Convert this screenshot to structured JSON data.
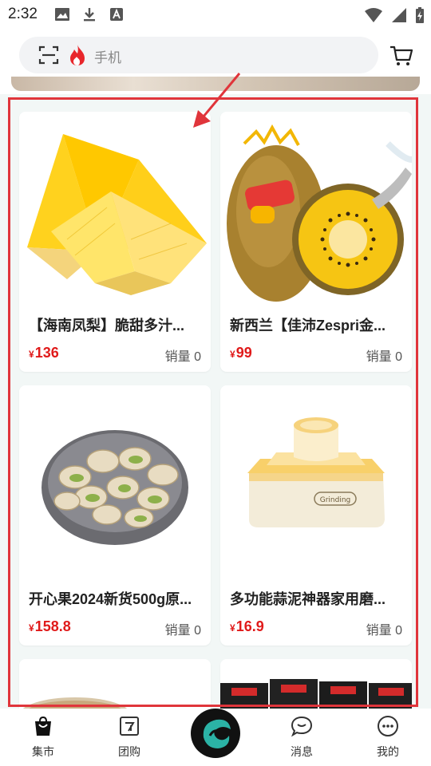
{
  "status_bar": {
    "time": "2:32"
  },
  "search": {
    "placeholder": "手机"
  },
  "products": [
    {
      "title": "【海南凤梨】脆甜多汁...",
      "price": "136",
      "currency": "¥",
      "sales": "销量 0",
      "image": "pineapple"
    },
    {
      "title": "新西兰【佳沛Zespri金...",
      "price": "99",
      "currency": "¥",
      "sales": "销量 0",
      "image": "kiwi"
    },
    {
      "title": "开心果2024新货500g原...",
      "price": "158.8",
      "currency": "¥",
      "sales": "销量 0",
      "image": "pistachio"
    },
    {
      "title": "多功能蒜泥神器家用磨...",
      "price": "16.9",
      "currency": "¥",
      "sales": "销量 0",
      "image": "garlic-grinder"
    }
  ],
  "bottom_nav": [
    {
      "label": "集市",
      "icon": "shopping-bag-icon"
    },
    {
      "label": "团购",
      "icon": "group-buy-icon"
    },
    {
      "label": "",
      "icon": "app-logo-icon"
    },
    {
      "label": "消息",
      "icon": "chat-bubble-icon"
    },
    {
      "label": "我的",
      "icon": "profile-dots-icon"
    }
  ],
  "colors": {
    "accent_red": "#e01a1a",
    "highlight_border": "#e0353b",
    "page_bg": "#f2f7f6"
  }
}
